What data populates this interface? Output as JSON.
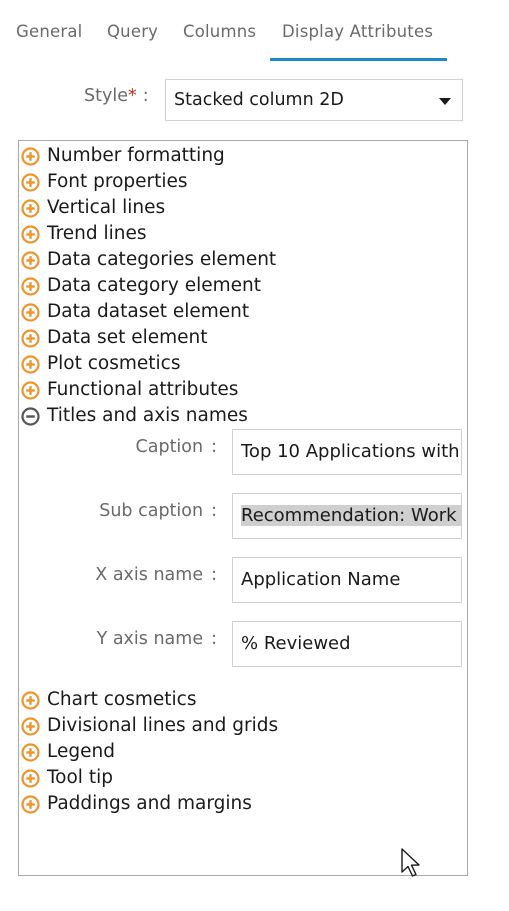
{
  "tabs": [
    {
      "label": "General"
    },
    {
      "label": "Query"
    },
    {
      "label": "Columns"
    },
    {
      "label": "Display Attributes"
    }
  ],
  "active_tab": "Display Attributes",
  "style": {
    "label": "Style",
    "required_mark": "*",
    "colon": ":",
    "value": "Stacked column 2D"
  },
  "tree": {
    "collapsed_before": [
      "Number formatting",
      "Font properties",
      "Vertical lines",
      "Trend lines",
      "Data categories element",
      "Data category element",
      "Data dataset element",
      "Data set element",
      "Plot cosmetics",
      "Functional attributes"
    ],
    "expanded": {
      "label": "Titles and axis names",
      "fields": [
        {
          "label": "Caption",
          "colon": ":",
          "value": "Top 10 Applications with"
        },
        {
          "label": "Sub caption",
          "colon": ":",
          "value": "Recommendation: Work"
        },
        {
          "label": "X axis name",
          "colon": ":",
          "value": "Application Name"
        },
        {
          "label": "Y axis name",
          "colon": ":",
          "value": "% Reviewed"
        }
      ]
    },
    "collapsed_after": [
      "Chart cosmetics",
      "Divisional lines and grids",
      "Legend",
      "Tool tip",
      "Paddings and margins"
    ]
  },
  "colors": {
    "accent": "#1f8bc6",
    "expand_icon": "#f0932b",
    "collapse_icon": "#555555",
    "required": "#c7301f"
  },
  "icons": {
    "expand": "plus-circle-icon",
    "collapse": "minus-circle-icon",
    "dropdown": "caret-down-icon",
    "cursor": "mouse-pointer-icon"
  }
}
